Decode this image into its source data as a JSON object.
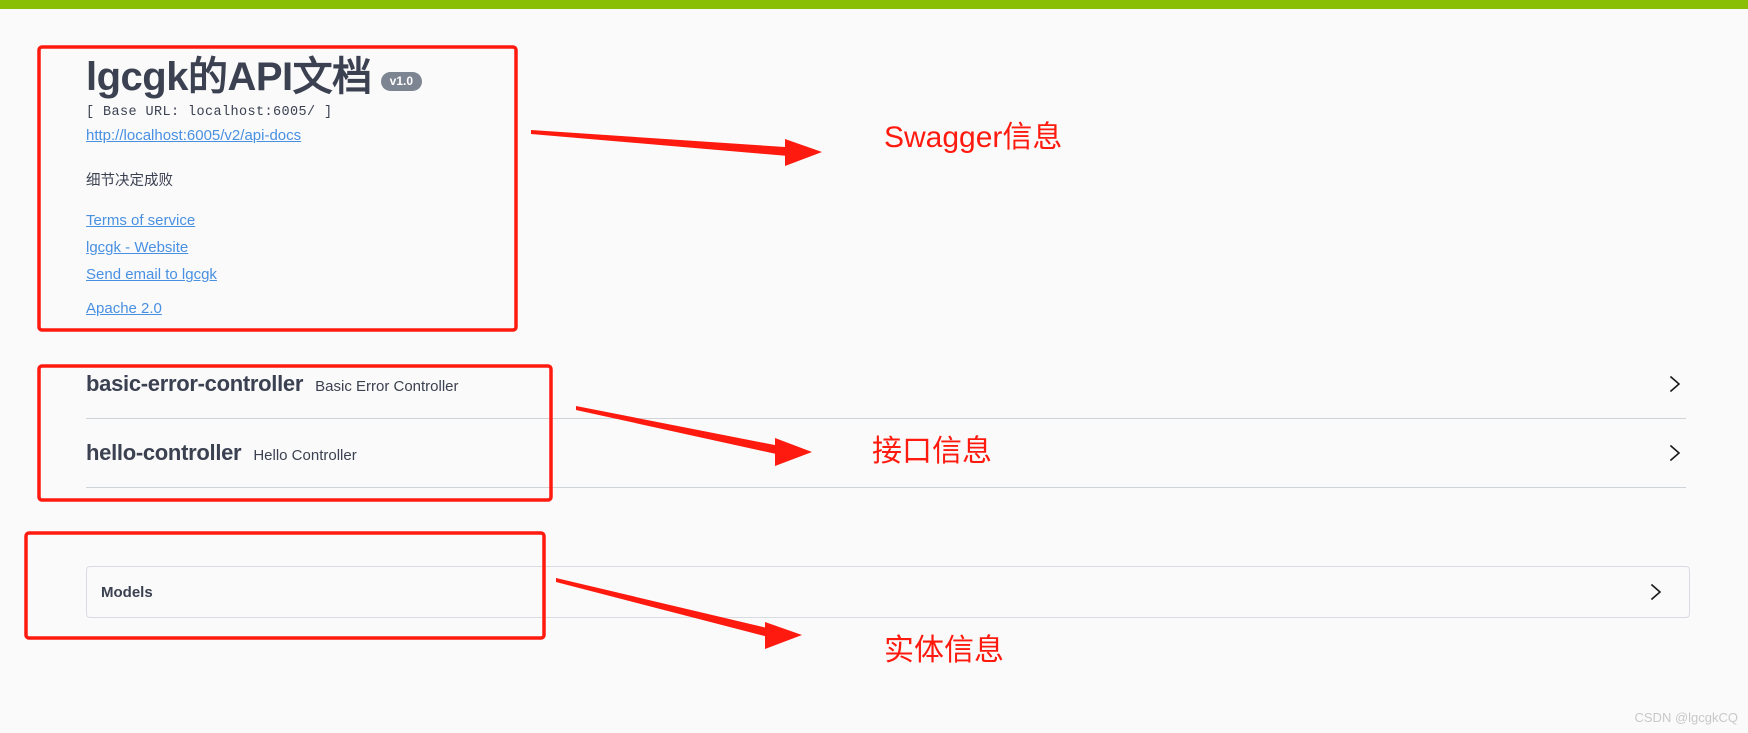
{
  "topbar": {
    "color": "#89bf04"
  },
  "info": {
    "title": "lgcgk的API文档",
    "version_badge": "v1.0",
    "base_url": "[ Base URL: localhost:6005/ ]",
    "docs_link": "http://localhost:6005/v2/api-docs",
    "description": "细节决定成败",
    "terms_link": "Terms of service",
    "website_link": "lgcgk - Website",
    "email_link": "Send email to lgcgk",
    "license_link": "Apache 2.0"
  },
  "tags": [
    {
      "name": "basic-error-controller",
      "description": "Basic Error Controller",
      "expand_icon": "chevron-right-icon"
    },
    {
      "name": "hello-controller",
      "description": "Hello Controller",
      "expand_icon": "chevron-right-icon"
    }
  ],
  "models": {
    "label": "Models",
    "expand_icon": "chevron-right-icon"
  },
  "annotations": {
    "color": "#ff1a0f",
    "swagger_info": "Swagger信息",
    "api_info": "接口信息",
    "entity_info": "实体信息"
  },
  "watermark": "CSDN @lgcgkCQ"
}
